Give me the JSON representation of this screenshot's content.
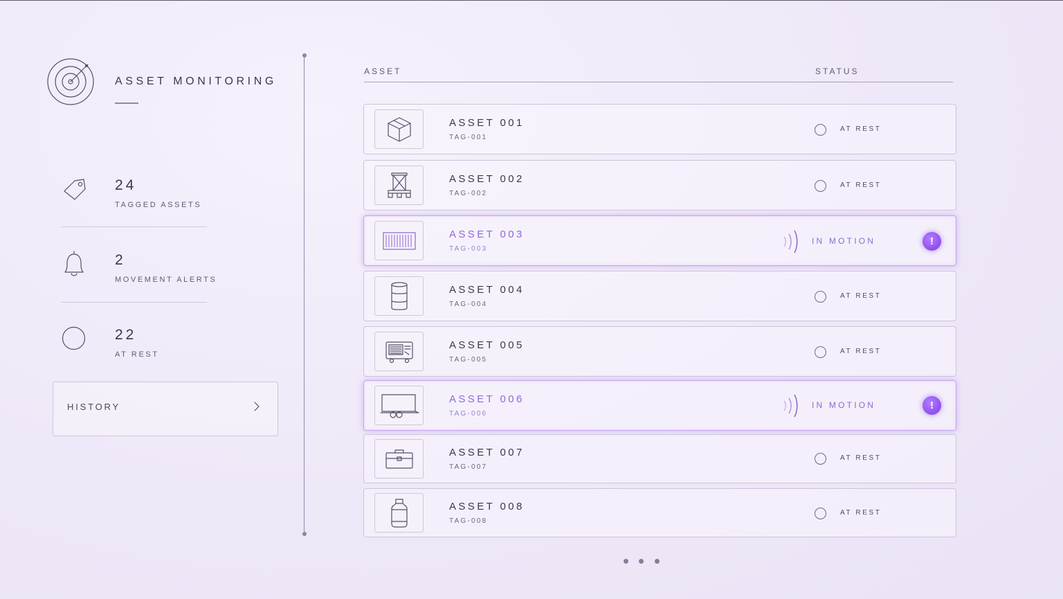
{
  "app": {
    "title": "ASSET MONITORING",
    "logo_icon": "radar-target-icon"
  },
  "summary": [
    {
      "icon": "tag-icon",
      "value": "24",
      "label": "TAGGED ASSETS"
    },
    {
      "icon": "bell-icon",
      "value": "2",
      "label": "MOVEMENT ALERTS"
    },
    {
      "icon": "circle-icon",
      "value": "22",
      "label": "AT REST"
    }
  ],
  "history": {
    "label": "HISTORY",
    "icon": "chevron-right-icon"
  },
  "table": {
    "headers": {
      "asset": "ASSET",
      "status": "STATUS"
    },
    "rows": [
      {
        "name": "ASSET 001",
        "tag": "TAG-001",
        "status": "AT REST",
        "icon": "box-icon",
        "alert": false
      },
      {
        "name": "ASSET 002",
        "tag": "TAG-002",
        "status": "AT REST",
        "icon": "pallet-jack-icon",
        "alert": false
      },
      {
        "name": "ASSET 003",
        "tag": "TAG-003",
        "status": "IN MOTION",
        "icon": "shipping-container-icon",
        "alert": true,
        "badge": "!"
      },
      {
        "name": "ASSET 004",
        "tag": "TAG-004",
        "status": "AT REST",
        "icon": "barrel-icon",
        "alert": false
      },
      {
        "name": "ASSET 005",
        "tag": "TAG-005",
        "status": "AT REST",
        "icon": "generator-icon",
        "alert": false
      },
      {
        "name": "ASSET 006",
        "tag": "TAG-006",
        "status": "IN MOTION",
        "icon": "trailer-icon",
        "alert": true,
        "badge": "!"
      },
      {
        "name": "ASSET 007",
        "tag": "TAG-007",
        "status": "AT REST",
        "icon": "toolbox-icon",
        "alert": false
      },
      {
        "name": "ASSET 008",
        "tag": "TAG-008",
        "status": "AT REST",
        "icon": "gas-cylinder-icon",
        "alert": false
      }
    ]
  },
  "pagination": {
    "page_count": 3
  },
  "colors": {
    "accent": "#9366dc",
    "alert_badge": "#8f4fed",
    "background": "#efe8f8",
    "text": "#3b3850"
  }
}
